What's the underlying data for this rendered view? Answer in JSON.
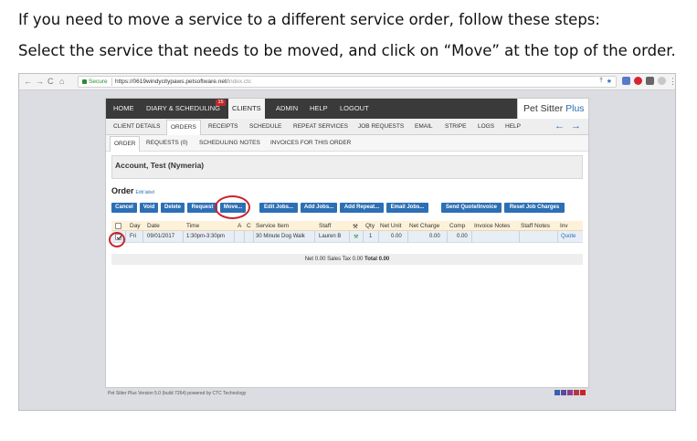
{
  "doc": {
    "line1": "If you need to move a service to a different service order, follow these steps:",
    "line2": "Select the service that needs to be moved, and click on “Move” at the top of the order."
  },
  "browser": {
    "back": "←",
    "forward": "→",
    "reload": "C",
    "home": "⌂",
    "secure_label": "Secure",
    "url_host": "https://0619windycitypaws.petsoftware.net/",
    "url_path": "index.ctc",
    "menu_icon": "⋮",
    "star_icon": "★",
    "key_icon": "†"
  },
  "app": {
    "brand_main": "Pet Sitter",
    "brand_plus": "Plus",
    "badge_count": "15",
    "nav": [
      {
        "label": "HOME"
      },
      {
        "label": "DIARY & SCHEDULING"
      },
      {
        "label": "CLIENTS"
      },
      {
        "label": "ADMIN"
      },
      {
        "label": "HELP"
      },
      {
        "label": "LOGOUT"
      }
    ],
    "subtabs": [
      {
        "label": "CLIENT DETAILS"
      },
      {
        "label": "ORDERS"
      },
      {
        "label": "RECEIPTS"
      },
      {
        "label": "SCHEDULE"
      },
      {
        "label": "REPEAT SERVICES"
      },
      {
        "label": "JOB REQUESTS"
      },
      {
        "label": "EMAIL"
      },
      {
        "label": "STRIPE"
      },
      {
        "label": "LOGS"
      },
      {
        "label": "HELP"
      }
    ],
    "arrows": "← →",
    "subtabs2": [
      {
        "label": "ORDER"
      },
      {
        "label": "REQUESTS (0)"
      },
      {
        "label": "SCHEDULING NOTES"
      },
      {
        "label": "INVOICES FOR THIS ORDER"
      }
    ],
    "account_title": "Account, Test (Nymeria)",
    "order_label": "Order",
    "edit_label": "Edit label",
    "buttons": [
      {
        "label": "Cancel"
      },
      {
        "label": "Void"
      },
      {
        "label": "Delete"
      },
      {
        "label": "Request"
      },
      {
        "label": "Move..."
      },
      {
        "label": "Edit Jobs..."
      },
      {
        "label": "Add Jobs..."
      },
      {
        "label": "Add Repeat..."
      },
      {
        "label": "Email Jobs..."
      },
      {
        "label": "Send Quote/Invoice"
      },
      {
        "label": "Reset Job Charges"
      }
    ],
    "table": {
      "headers": [
        "Day",
        "Date",
        "Time",
        "A",
        "C",
        "Service Item",
        "Staff",
        "⚒",
        "Qty",
        "Net Unit",
        "Net Charge",
        "Comp",
        "Invoice Notes",
        "Staff Notes",
        "Inv"
      ],
      "row": {
        "day": "Fri",
        "date": "09/01/2017",
        "time": "1:30pm-3:30pm",
        "service": "30 Minute Dog Walk",
        "staff": "Lauren B",
        "tool": "⚒",
        "qty": "1",
        "net_unit": "0.00",
        "net_charge": "0.00",
        "comp": "0.00",
        "inv": "Quote"
      }
    },
    "totals": {
      "net": "Net 0.00",
      "tax": "Sales Tax 0.00",
      "total": "Total 0.00"
    },
    "footer": "Pet Sitter Plus Version 5.0 (build 7264) powered by CTC Technology",
    "colors": {
      "accent": "#2d6fb5",
      "topbar": "#3a3a3a",
      "highlight": "#c8242b",
      "swatches": [
        "#3b5fae",
        "#5a4c9c",
        "#8a3f92",
        "#b33a3a",
        "#c8242b"
      ]
    }
  }
}
